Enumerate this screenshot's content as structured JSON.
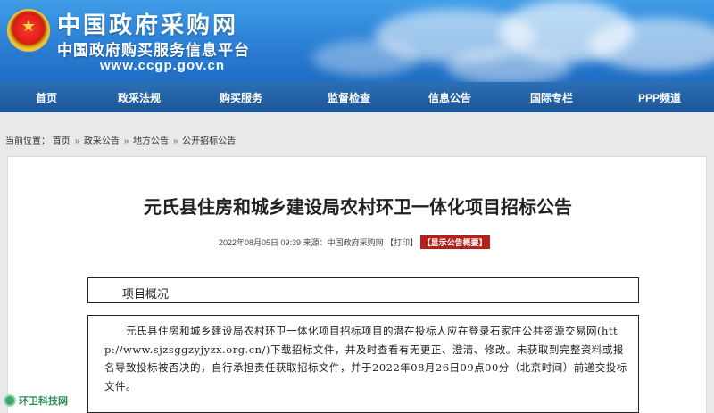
{
  "header": {
    "title": "中国政府采购网",
    "subtitle": "中国政府购买服务信息平台",
    "url": "www.ccgp.gov.cn",
    "emblem_icon": "national-emblem-icon"
  },
  "nav": {
    "items": [
      "首页",
      "政采法规",
      "购买服务",
      "监督检查",
      "信息公告",
      "国际专栏",
      "PPP频道"
    ]
  },
  "breadcrumb": {
    "prefix": "当前位置：",
    "items": [
      "首页",
      "政采公告",
      "地方公告",
      "公开招标公告"
    ],
    "separator": "»"
  },
  "article": {
    "title": "元氏县住房和城乡建设局农村环卫一体化项目招标公告",
    "date": "2022年08月05日 09:39",
    "source_label": "来源：",
    "source": "中国政府采购网",
    "print_label": "【打印】",
    "notice_badge": "【显示公告概要】",
    "section_heading": "项目概况",
    "body": "元氏县住房和城乡建设局农村环卫一体化项目招标项目的潜在投标人应在登录石家庄公共资源交易网(http://www.sjzsggzyjyzx.org.cn/)下载招标文件，并及时查看有无更正、澄清、修改。未获取到完整资料或报名导致投标被否决的，自行承担责任获取招标文件，并于2022年08月26日09点00分（北京时间）前递交投标文件。"
  },
  "watermark": {
    "text": "环卫科技网"
  },
  "colors": {
    "banner": "#2b7fd4",
    "nav": "#1d5596",
    "badge": "#b3221a",
    "watermark": "#2e8b57"
  }
}
